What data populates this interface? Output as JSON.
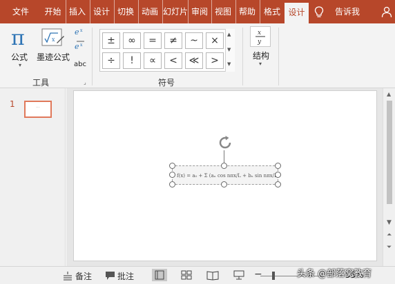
{
  "tabs": [
    "文件",
    "开始",
    "插入",
    "设计",
    "切换",
    "动画",
    "幻灯片",
    "审阅",
    "视图",
    "帮助",
    "格式",
    "设计",
    "告诉我"
  ],
  "ribbon": {
    "formula_label": "公式",
    "ink_formula_label": "墨迹公式",
    "abc_label": "abc",
    "tools_group": "工具",
    "symbols": [
      "±",
      "∞",
      "=",
      "≠",
      "~",
      "×",
      "÷",
      "!",
      "∝",
      "<",
      "≪",
      ">"
    ],
    "symbols_group": "符号",
    "structure_label": "结构"
  },
  "thumbnail": {
    "number": "1"
  },
  "equation_text": "f(x) = a₀ + Σ (aₙ cos nπx/L + bₙ sin nπx/L)",
  "status": {
    "notes": "备注",
    "comments": "批注",
    "zoom": "55%"
  },
  "watermark": "头条 @部落窝教育",
  "colors": {
    "accent": "#b7472a",
    "formula_blue": "#2e74b5"
  }
}
